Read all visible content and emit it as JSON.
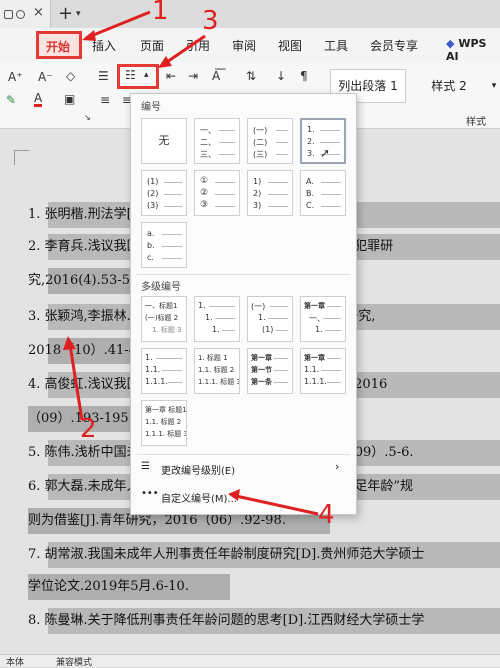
{
  "menu": {
    "items": [
      "开始",
      "插入",
      "页面",
      "引用",
      "审阅",
      "视图",
      "工具",
      "会员专享"
    ],
    "wps_ai": "WPS AI"
  },
  "ribbon": {
    "style_list_para": "列出段落 1",
    "style_2": "样式 2",
    "styles_group_label": "样式"
  },
  "panel": {
    "numbering_section": "编号",
    "none_label": "无",
    "single_styles": [
      {
        "marks": [
          "一、",
          "二、",
          "三、"
        ]
      },
      {
        "marks": [
          "(一)",
          "(二)",
          "(三)"
        ]
      },
      {
        "marks": [
          "1.",
          "2.",
          "3."
        ]
      },
      {
        "marks": [
          "(1)",
          "(2)",
          "(3)"
        ]
      },
      {
        "marks": [
          "①",
          "②",
          "③"
        ]
      },
      {
        "marks": [
          "1)",
          "2)",
          "3)"
        ]
      },
      {
        "marks": [
          "A.",
          "B.",
          "C."
        ]
      },
      {
        "marks": [
          "a.",
          "b.",
          "c."
        ]
      }
    ],
    "multilevel_section": "多级编号",
    "multilevel_styles": [
      {
        "marks": [
          "一、标题1",
          "(一)标题 2",
          "1. 标题 3"
        ]
      },
      {
        "marks": [
          "1.",
          "1.",
          "1."
        ]
      },
      {
        "marks": [
          "(一)",
          "1.",
          "(1)"
        ]
      },
      {
        "marks": [
          "第一章",
          "一、",
          "1."
        ]
      },
      {
        "marks": [
          "1.",
          "1.1.",
          "1.1.1."
        ]
      },
      {
        "marks": [
          "1. 标题 1",
          "1.1. 标题 2",
          "1.1.1. 标题 3"
        ]
      },
      {
        "marks": [
          "第一章",
          "第一节",
          "第一条"
        ]
      },
      {
        "marks": [
          "第一章",
          "1.1.",
          "1.1.1."
        ]
      },
      {
        "marks": [
          "第一章 标题1",
          "1.1. 标题 2",
          "1.1.1. 标题 3"
        ]
      }
    ],
    "change_level": "更改编号级别(E)",
    "custom": "自定义编号(M)..."
  },
  "document": {
    "lines": [
      "1.  张明楷.刑法学[M].法律出版社，2011.289.",
      "2.  李育兵.浅议我国未成年人刑事责任年龄[J].预防青少年犯罪研",
      "究,2016(4).53-58.",
      "3.  张颖鸿,李振林.降低刑事责任年龄之理论[J].中国青年研究,",
      "2018（10）.41-46.",
      "4.  高俊虹.浅议我国刑事责任年龄的调整[J].法制与经济，2016",
      "（09）.193-195.",
      "5.  陈伟.浅析中国未成年人刑事责任年龄的社会，2013（09）.5-6.",
      "6.  郭大磊.未成年人犯罪低龄化问题之应对——以“恶意补足年龄”规",
      "则为借鉴[J].青年研究，2016（06）.92-98.",
      "7.  胡常淑.我国未成年人刑事责任年龄制度研究[D].贵州师范大学硕士",
      "学位论文.2019年5月.6-10.",
      "8.  陈曼琳.关于降低刑事责任年龄问题的思考[D].江西财经大学硕士学"
    ]
  },
  "statusbar": {
    "left": "本体",
    "mode": "兼容模式"
  },
  "annotations": [
    "1",
    "2",
    "3",
    "4"
  ],
  "colors": {
    "annotation": "#e02020",
    "selection": "#b9b9b9"
  }
}
